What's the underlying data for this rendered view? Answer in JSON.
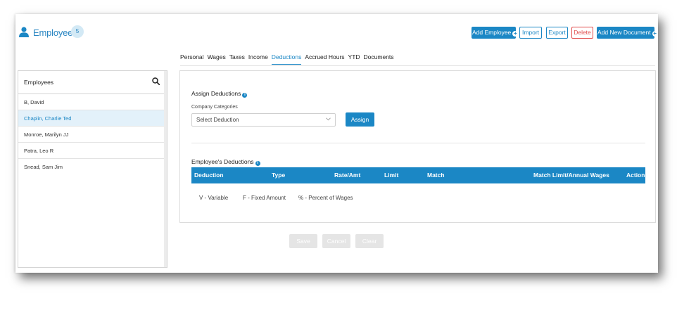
{
  "header": {
    "title": "Employees",
    "count": "5",
    "buttons": {
      "add_employee": "Add Employee",
      "import": "Import",
      "export": "Export",
      "delete": "Delete",
      "add_document": "Add New Document"
    }
  },
  "tabs": [
    "Personal",
    "Wages",
    "Taxes",
    "Income",
    "Deductions",
    "Accrued Hours",
    "YTD",
    "Documents"
  ],
  "active_tab": "Deductions",
  "sidebar": {
    "title": "Employees",
    "employees": [
      "B, David",
      "Chaplin, Charlie Ted",
      "Monroe, Marilyn JJ",
      "Patra, Leo R",
      "Snead, Sam Jim"
    ],
    "selected": "Chaplin, Charlie Ted"
  },
  "assign": {
    "title": "Assign Deductions",
    "field_label": "Company Categories",
    "select_value": "Select Deduction",
    "button": "Assign"
  },
  "employee_deductions": {
    "title": "Employee's Deductions",
    "columns": [
      "Deduction",
      "Type",
      "Rate/Amt",
      "Limit",
      "Match",
      "Match Limit/Annual Wages",
      "Action"
    ],
    "legend": [
      "V - Variable",
      "F - Fixed Amount",
      "% - Percent of Wages"
    ]
  },
  "footer": {
    "save": "Save",
    "cancel": "Cancel",
    "clear": "Clear"
  },
  "colors": {
    "accent": "#1b87c5",
    "danger": "#e04a4a",
    "selected_row": "#e3f1fa",
    "disabled_button": "#e5e5e5"
  }
}
